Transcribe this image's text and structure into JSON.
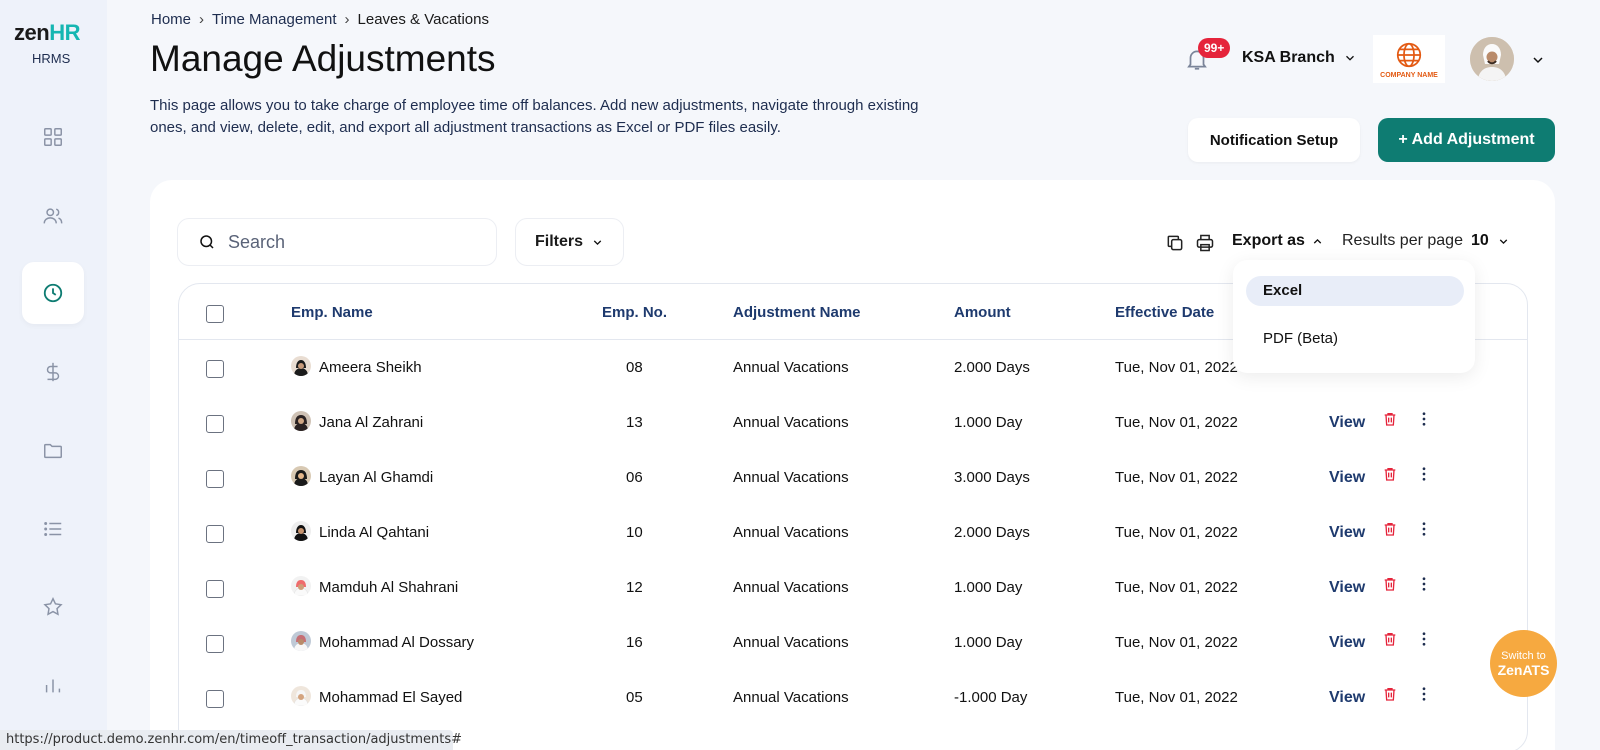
{
  "brand": {
    "zen": "zen",
    "hr": "HR",
    "sub": "HRMS"
  },
  "breadcrumb": [
    {
      "label": "Home"
    },
    {
      "label": "Time Management"
    },
    {
      "label": "Leaves & Vacations"
    }
  ],
  "page": {
    "title": "Manage Adjustments",
    "description": "This page allows you to take charge of employee time off balances. Add new adjustments, navigate through existing ones, and view, delete, edit, and export all adjustment transactions as Excel or PDF files easily."
  },
  "header": {
    "notifications_badge": "99+",
    "branch": "KSA Branch",
    "company_logo_text": "COMPANY NAME"
  },
  "actions": {
    "notification_setup": "Notification Setup",
    "add_adjustment": "+ Add Adjustment"
  },
  "toolbar": {
    "search_placeholder": "Search",
    "filters": "Filters",
    "export_as": "Export as",
    "results_per_page_label": "Results per page",
    "results_per_page_value": "10"
  },
  "export_menu": {
    "options": [
      "Excel",
      "PDF (Beta)"
    ],
    "selected": "Excel"
  },
  "table": {
    "columns": [
      "Emp. Name",
      "Emp. No.",
      "Adjustment Name",
      "Amount",
      "Effective Date"
    ],
    "view_label": "View",
    "rows": [
      {
        "name": "Ameera Sheikh",
        "no": "08",
        "adjustment": "Annual Vacations",
        "amount": "2.000 Days",
        "date": "Tue, Nov 01, 2022"
      },
      {
        "name": "Jana Al Zahrani",
        "no": "13",
        "adjustment": "Annual Vacations",
        "amount": "1.000 Day",
        "date": "Tue, Nov 01, 2022"
      },
      {
        "name": "Layan Al Ghamdi",
        "no": "06",
        "adjustment": "Annual Vacations",
        "amount": "3.000 Days",
        "date": "Tue, Nov 01, 2022"
      },
      {
        "name": "Linda Al Qahtani",
        "no": "10",
        "adjustment": "Annual Vacations",
        "amount": "2.000 Days",
        "date": "Tue, Nov 01, 2022"
      },
      {
        "name": "Mamduh Al Shahrani",
        "no": "12",
        "adjustment": "Annual Vacations",
        "amount": "1.000 Day",
        "date": "Tue, Nov 01, 2022"
      },
      {
        "name": "Mohammad Al Dossary",
        "no": "16",
        "adjustment": "Annual Vacations",
        "amount": "1.000 Day",
        "date": "Tue, Nov 01, 2022"
      },
      {
        "name": "Mohammad El Sayed",
        "no": "05",
        "adjustment": "Annual Vacations",
        "amount": "-1.000 Day",
        "date": "Tue, Nov 01, 2022"
      }
    ]
  },
  "switch_widget": {
    "line1": "Switch to",
    "line2": "ZenATS"
  },
  "status_url": "https://product.demo.zenhr.com/en/timeoff_transaction/adjustments#",
  "colors": {
    "accent": "#0e7c72",
    "brand_hr": "#15b6b2",
    "danger": "#e5243b",
    "link": "#1e3a6e",
    "switch": "#f6a940"
  }
}
